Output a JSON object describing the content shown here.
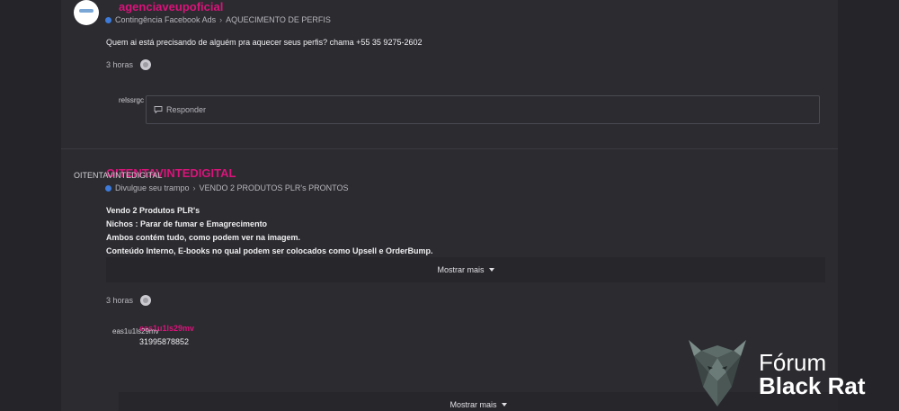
{
  "post1": {
    "author": "agenciaveupoficial",
    "category": "Contingência Facebook Ads",
    "subcategory": "AQUECIMENTO DE PERFIS",
    "text": "Quem ai está precisando de alguém pra aquecer seus perfis? chama +55 35 9275-2602",
    "time": "3 horas",
    "reply_avatar_alt": "relssrgc",
    "reply_placeholder": "Responder"
  },
  "post2": {
    "avatar_alt": "OITENTAVINTEDIGITAL",
    "author": "OITENTAVINTEDIGITAL",
    "category": "Divulgue seu trampo",
    "subcategory": "VENDO 2 PRODUTOS PLR's PRONTOS",
    "lines": [
      "Vendo 2 Produtos PLR's",
      "Nichos : Parar de fumar e Emagrecimento",
      "Ambos contém tudo, como podem ver na imagem.",
      "Conteúdo Interno, E-books no qual podem ser colocados como Upsell e OrderBump."
    ],
    "show_more": "Mostrar mais",
    "time": "3 horas"
  },
  "comment": {
    "avatar_alt": "eas1u1ls29mv",
    "author": "eas1u1ls29mv",
    "text": "31995878852",
    "show_more": "Mostrar mais"
  },
  "brand": {
    "line1": "Fórum",
    "line2": "Black Rat"
  },
  "colors": {
    "accent": "#d9147a",
    "category_dot": "#3d7ad9",
    "background": "#242429",
    "panel": "#2b2b30"
  }
}
